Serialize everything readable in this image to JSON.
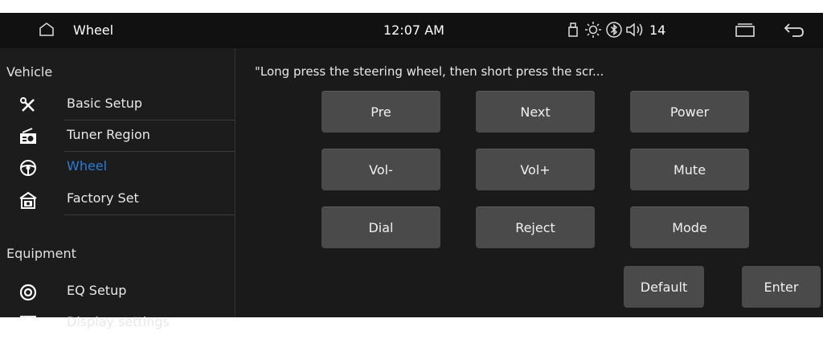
{
  "statusbar": {
    "title": "Wheel",
    "time": "12:07 AM",
    "volume_level": "14",
    "icons": [
      "home-icon",
      "usb-icon",
      "brightness-icon",
      "bluetooth-icon",
      "volume-icon",
      "recent-apps-icon",
      "back-icon"
    ]
  },
  "sidebar": {
    "section_vehicle": "Vehicle",
    "section_equipment": "Equipment",
    "items": [
      {
        "label": "Basic Setup",
        "icon": "tools-icon"
      },
      {
        "label": "Tuner Region",
        "icon": "radio-icon"
      },
      {
        "label": "Wheel",
        "icon": "steering-wheel-icon",
        "active": true
      },
      {
        "label": "Factory Set",
        "icon": "factory-icon"
      },
      {
        "label": "EQ Setup",
        "icon": "speaker-icon"
      },
      {
        "label": "Display settings",
        "icon": "display-icon"
      }
    ],
    "active_color": "#2e7bd6"
  },
  "main": {
    "hint": "\"Long press the steering wheel, then short press the scr...",
    "keys": [
      "Pre",
      "Next",
      "Power",
      "Vol-",
      "Vol+",
      "Mute",
      "Dial",
      "Reject",
      "Mode"
    ],
    "default_label": "Default",
    "enter_label": "Enter"
  }
}
